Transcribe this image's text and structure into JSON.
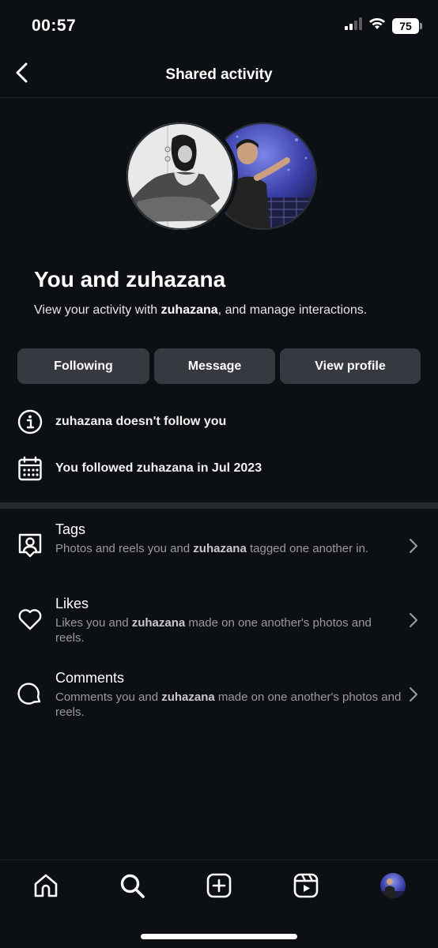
{
  "status_bar": {
    "time": "00:57",
    "battery": "75"
  },
  "header": {
    "title": "Shared activity"
  },
  "profile": {
    "title": "You and zuhazana",
    "subtitle_prefix": "View your activity with ",
    "subtitle_username": "zuhazana",
    "subtitle_suffix": ", and manage interactions."
  },
  "actions": {
    "following": "Following",
    "message": "Message",
    "view_profile": "View profile"
  },
  "info": {
    "follow_status": "zuhazana doesn't follow you",
    "followed_since": "You followed zuhazana in Jul 2023"
  },
  "list": [
    {
      "title": "Tags",
      "desc_prefix": "Photos and reels you and ",
      "username": "zuhazana",
      "desc_suffix": " tagged one another in."
    },
    {
      "title": "Likes",
      "desc_prefix": "Likes you and ",
      "username": "zuhazana",
      "desc_suffix": " made on one another's photos and reels."
    },
    {
      "title": "Comments",
      "desc_prefix": "Comments you and ",
      "username": "zuhazana",
      "desc_suffix": " made on one another's photos and reels."
    }
  ],
  "icons": {
    "back": "chevron-left-icon",
    "info": "info-icon",
    "calendar": "calendar-icon",
    "tags": "tag-person-icon",
    "likes": "heart-icon",
    "comments": "comment-icon",
    "tab_home": "home-icon",
    "tab_search": "search-icon",
    "tab_create": "plus-square-icon",
    "tab_reels": "reels-icon"
  },
  "colors": {
    "background": "#0c1014",
    "button": "#363a40",
    "divider": "#262a2f",
    "muted_text": "#9a9a9a"
  }
}
